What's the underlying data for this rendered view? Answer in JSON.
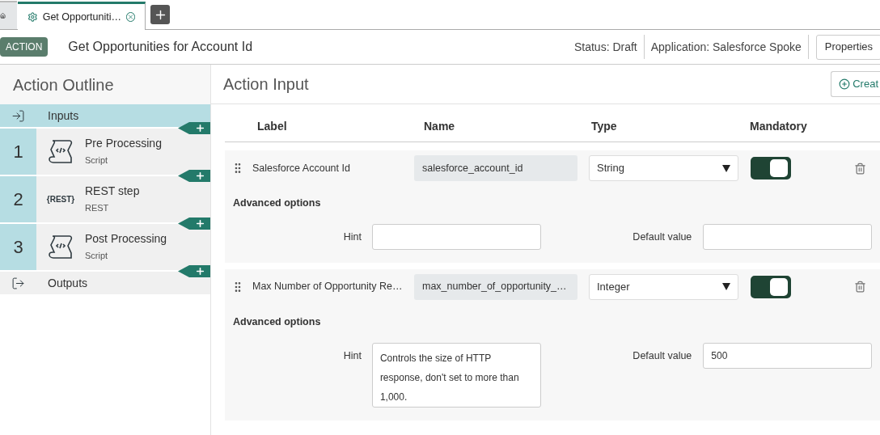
{
  "tabs": [
    {
      "kind": "home",
      "selected": false
    },
    {
      "kind": "page",
      "label": "Get Opportuniti…",
      "selected": true
    }
  ],
  "header": {
    "badge": "ACTION",
    "title": "Get Opportunities for Account Id",
    "status": "Status: Draft",
    "application": "Application: Salesforce Spoke",
    "properties_button": "Properties"
  },
  "outline": {
    "title": "Action Outline",
    "items": [
      {
        "kind": "inputs",
        "label": "Inputs",
        "selected": true
      },
      {
        "kind": "script_step",
        "number": "1",
        "label": "Pre Processing",
        "sublabel": "Script",
        "selected": false
      },
      {
        "kind": "rest_step",
        "number": "2",
        "icon_text": "{REST}",
        "label": "REST step",
        "sublabel": "REST",
        "selected": false
      },
      {
        "kind": "script_step",
        "number": "3",
        "label": "Post Processing",
        "sublabel": "Script",
        "selected": false
      },
      {
        "kind": "outputs",
        "label": "Outputs",
        "selected": false
      }
    ]
  },
  "input": {
    "title": "Action Input",
    "create_button": "Creat",
    "columns": [
      "Label",
      "Name",
      "Type",
      "Mandatory"
    ],
    "rows": [
      {
        "label": "Salesforce Account Id",
        "name": "salesforce_account_id",
        "type": "String",
        "mandatory": true,
        "advanced_title": "Advanced options",
        "hint_label": "Hint",
        "hint": "",
        "default_label": "Default value",
        "default_value": ""
      },
      {
        "label": "Max Number of Opportunity Re…",
        "name": "max_number_of_opportunity_…",
        "type": "Integer",
        "mandatory": true,
        "advanced_title": "Advanced options",
        "hint_label": "Hint",
        "hint": "Controls the size of HTTP response, don't set to more than 1,000.",
        "default_label": "Default value",
        "default_value": "500"
      }
    ]
  }
}
